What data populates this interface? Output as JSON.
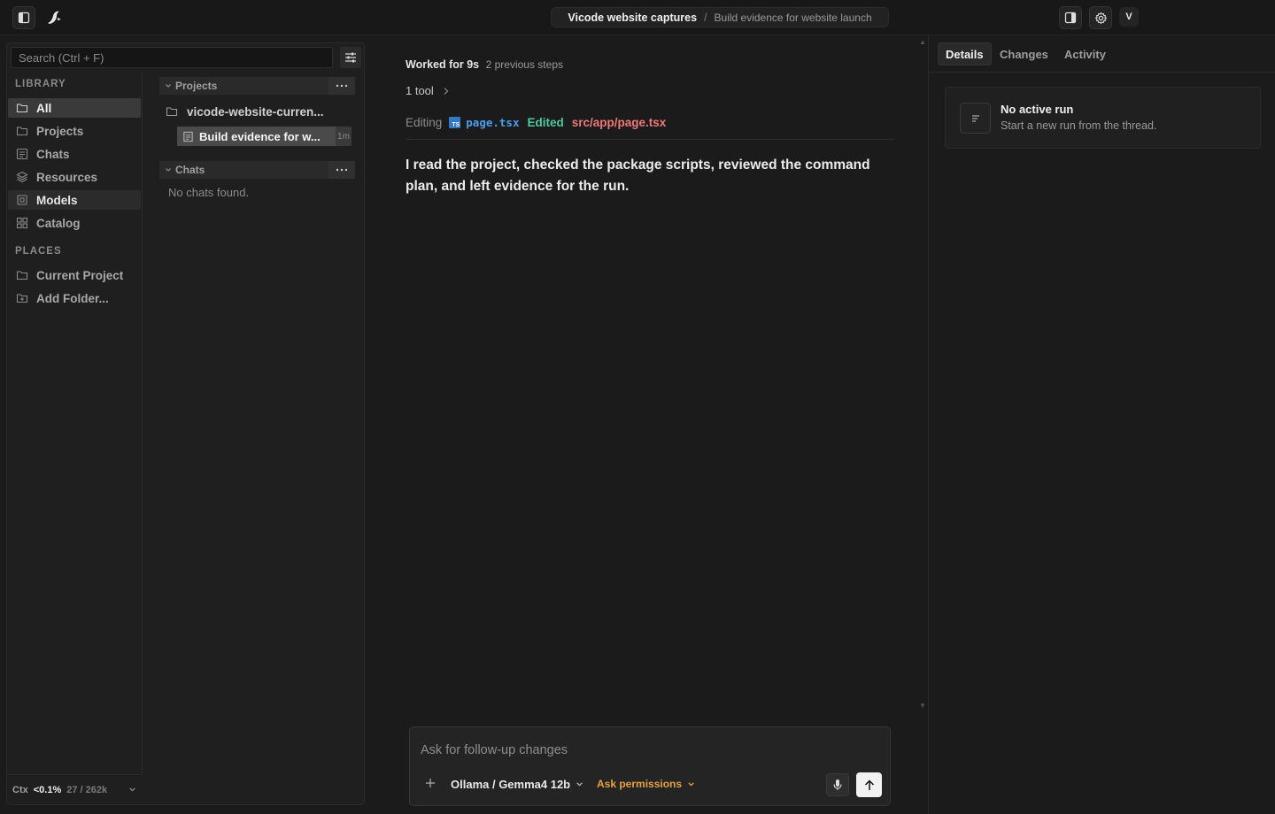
{
  "header": {
    "project": "Vicode website captures",
    "separator": "/",
    "thread": "Build evidence for website launch",
    "avatar_initial": "V"
  },
  "sidebar": {
    "search_placeholder": "Search (Ctrl + F)",
    "library_label": "LIBRARY",
    "library_items": [
      {
        "label": "All",
        "icon": "folder-icon",
        "state": "active"
      },
      {
        "label": "Projects",
        "icon": "folder-icon"
      },
      {
        "label": "Chats",
        "icon": "chat-icon"
      },
      {
        "label": "Resources",
        "icon": "layers-icon"
      },
      {
        "label": "Models",
        "icon": "cpu-icon",
        "state": "highlighted"
      },
      {
        "label": "Catalog",
        "icon": "grid-icon"
      }
    ],
    "places_label": "PLACES",
    "places_items": [
      {
        "label": "Current Project",
        "icon": "folder-icon"
      },
      {
        "label": "Add Folder...",
        "icon": "folder-plus-icon"
      }
    ],
    "projects_group": "Projects",
    "project_folder": "vicode-website-curren...",
    "active_thread": "Build evidence for w...",
    "active_thread_age": "1m",
    "chats_group": "Chats",
    "chats_empty": "No chats found.",
    "footer": {
      "ctx_label": "Ctx",
      "ctx_percent": "<0.1%",
      "ctx_tokens": "27 / 262k"
    }
  },
  "main": {
    "worked_for": "Worked for 9s",
    "previous_steps": "2 previous steps",
    "tool_count": "1 tool",
    "editing_label": "Editing",
    "file_badge": "TS",
    "file_name": "page.tsx",
    "edited_label": "Edited",
    "edited_path": "src/app/page.tsx",
    "message": "I read the project, checked the package scripts, reviewed the command plan, and left evidence for the run.",
    "composer": {
      "placeholder": "Ask for follow-up changes",
      "model": "Ollama / Gemma4 12b",
      "permissions": "Ask permissions"
    }
  },
  "right_panel": {
    "tabs": [
      "Details",
      "Changes",
      "Activity"
    ],
    "active_tab": "Details",
    "run_title": "No active run",
    "run_subtitle": "Start a new run from the thread."
  }
}
